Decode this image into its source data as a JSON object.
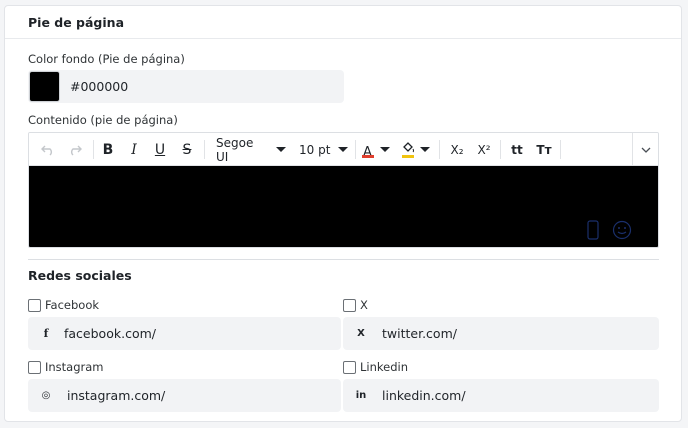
{
  "section": {
    "title": "Pie de página"
  },
  "background_color": {
    "label": "Color fondo (Pie de página)",
    "value": "#000000",
    "swatch_color": "#000000"
  },
  "content": {
    "label": "Contenido (pie de página)",
    "toolbar": {
      "undo_icon": "undo-icon",
      "redo_icon": "redo-icon",
      "bold": "B",
      "italic": "I",
      "underline": "U",
      "strikethrough": "S",
      "font_family": "Segoe UI",
      "font_size": "10 pt",
      "text_color_letter": "A",
      "text_color_accent": "#e03e2d",
      "highlight_accent": "#f1c40f",
      "subscript": "X₂",
      "superscript": "X²",
      "lowercase_icon": "tt",
      "uppercase_icon": "Tт"
    },
    "body_background": "#000000"
  },
  "social": {
    "title": "Redes sociales",
    "items": [
      {
        "label": "Facebook",
        "checked": false,
        "icon": "facebook-icon",
        "icon_glyph": "f",
        "value": "facebook.com/"
      },
      {
        "label": "X",
        "checked": false,
        "icon": "x-icon",
        "icon_glyph": "X",
        "value": "twitter.com/"
      },
      {
        "label": "Instagram",
        "checked": false,
        "icon": "instagram-icon",
        "icon_glyph": "◎",
        "value": "instagram.com/"
      },
      {
        "label": "Linkedin",
        "checked": false,
        "icon": "linkedin-icon",
        "icon_glyph": "in",
        "value": "linkedin.com/"
      }
    ]
  }
}
